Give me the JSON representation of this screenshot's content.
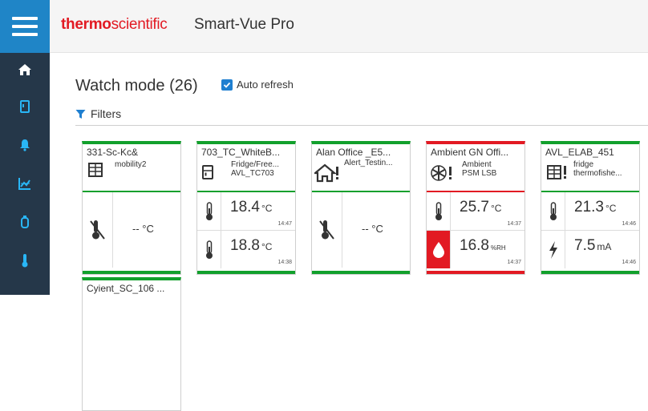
{
  "header": {
    "brand_part1": "thermo",
    "brand_part2": "scientific",
    "app_title": "Smart-Vue Pro"
  },
  "page": {
    "title": "Watch mode (26)",
    "auto_refresh_label": "Auto refresh",
    "auto_refresh_checked": true,
    "filters_label": "Filters"
  },
  "nav": {
    "items": [
      "home-icon",
      "device-icon",
      "bell-icon",
      "chart-icon",
      "sensor-icon",
      "thermometer-icon"
    ]
  },
  "colors": {
    "sidebar": "#253749",
    "accent": "#1f85c7",
    "ok": "#12a02c",
    "alarm": "#e21a23"
  },
  "cards": [
    {
      "name": "331-Sc-Kc&",
      "sub1": "mobility2",
      "sub2": "",
      "status": "ok",
      "value": "-- °C"
    },
    {
      "name": "703_TC_WhiteB...",
      "sub1": "Fridge/Free...",
      "sub2": "AVL_TC703",
      "status": "ok",
      "r1_value": "18.4",
      "r1_unit": "°C",
      "r1_time": "14:47",
      "r2_value": "18.8",
      "r2_unit": "°C",
      "r2_time": "14:38"
    },
    {
      "name": "Alan Office _E5...",
      "sub1": "Alert_Testin...",
      "sub2": "",
      "status": "ok",
      "value": "-- °C"
    },
    {
      "name": "Ambient GN Offi...",
      "sub1": "Ambient",
      "sub2": "PSM LSB",
      "status": "alarm",
      "r1_value": "25.7",
      "r1_unit": "°C",
      "r1_time": "14:37",
      "r2_value": "16.8",
      "r2_unit": "%RH",
      "r2_time": "14:37"
    },
    {
      "name": "AVL_ELAB_451",
      "sub1": "fridge",
      "sub2": "thermofishe...",
      "status": "ok",
      "r1_value": "21.3",
      "r1_unit": "°C",
      "r1_time": "14:46",
      "r2_value": "7.5",
      "r2_unit": "mA",
      "r2_time": "14:46"
    },
    {
      "name": "Cyient_SC_106 ...",
      "status": "ok"
    }
  ]
}
